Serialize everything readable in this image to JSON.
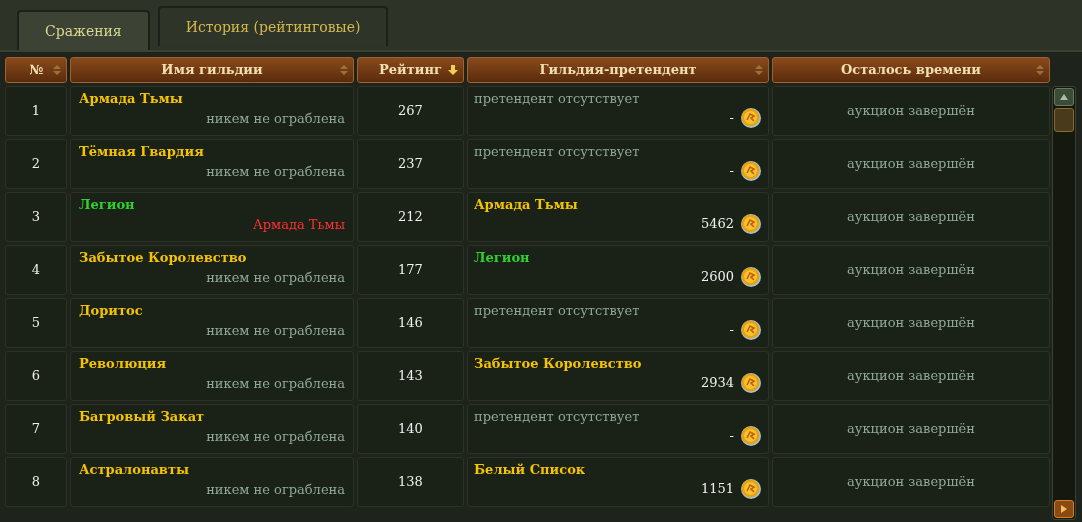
{
  "tabs": [
    {
      "label": "Сражения",
      "selected": true
    },
    {
      "label": "История (рейтинговые)",
      "selected": false
    }
  ],
  "columns": [
    {
      "label": "№",
      "sorted": false
    },
    {
      "label": "Имя гильдии",
      "sorted": false
    },
    {
      "label": "Рейтинг",
      "sorted": true
    },
    {
      "label": "Гильдия-претендент",
      "sorted": false
    },
    {
      "label": "Осталось времени",
      "sorted": false
    }
  ],
  "rows": [
    {
      "rank": "1",
      "guild": {
        "name": "Армада Тьмы",
        "color": "#f5c400"
      },
      "robbed_by": {
        "text": "никем не ограблена",
        "color": "#8fa89a"
      },
      "rating": "267",
      "challenger": {
        "kind": "none",
        "text": "претендент отсутствует",
        "bid": "-"
      },
      "time_left": "аукцион завершён"
    },
    {
      "rank": "2",
      "guild": {
        "name": "Тёмная Гвардия",
        "color": "#f5c400"
      },
      "robbed_by": {
        "text": "никем не ограблена",
        "color": "#8fa89a"
      },
      "rating": "237",
      "challenger": {
        "kind": "none",
        "text": "претендент отсутствует",
        "bid": "-"
      },
      "time_left": "аукцион завершён"
    },
    {
      "rank": "3",
      "guild": {
        "name": "Легион",
        "color": "#2ed12e"
      },
      "robbed_by": {
        "text": "Армада Тьмы",
        "color": "#ff3030"
      },
      "rating": "212",
      "challenger": {
        "kind": "guild",
        "text": "Армада Тьмы",
        "color": "#f5c400",
        "bid": "5462"
      },
      "time_left": "аукцион завершён"
    },
    {
      "rank": "4",
      "guild": {
        "name": "Забытое Королевство",
        "color": "#f5c400"
      },
      "robbed_by": {
        "text": "никем не ограблена",
        "color": "#8fa89a"
      },
      "rating": "177",
      "challenger": {
        "kind": "guild",
        "text": "Легион",
        "color": "#2ed12e",
        "bid": "2600"
      },
      "time_left": "аукцион завершён"
    },
    {
      "rank": "5",
      "guild": {
        "name": "Доритос",
        "color": "#f5c400"
      },
      "robbed_by": {
        "text": "никем не ограблена",
        "color": "#8fa89a"
      },
      "rating": "146",
      "challenger": {
        "kind": "none",
        "text": "претендент отсутствует",
        "bid": "-"
      },
      "time_left": "аукцион завершён"
    },
    {
      "rank": "6",
      "guild": {
        "name": "Революция",
        "color": "#f5c400"
      },
      "robbed_by": {
        "text": "никем не ограблена",
        "color": "#8fa89a"
      },
      "rating": "143",
      "challenger": {
        "kind": "guild",
        "text": "Забытое Королевство",
        "color": "#f5c400",
        "bid": "2934"
      },
      "time_left": "аукцион завершён"
    },
    {
      "rank": "7",
      "guild": {
        "name": "Багровый Закат",
        "color": "#f5c400"
      },
      "robbed_by": {
        "text": "никем не ограблена",
        "color": "#8fa89a"
      },
      "rating": "140",
      "challenger": {
        "kind": "none",
        "text": "претендент отсутствует",
        "bid": "-"
      },
      "time_left": "аукцион завершён"
    },
    {
      "rank": "8",
      "guild": {
        "name": "Астралонавты",
        "color": "#f5c400"
      },
      "robbed_by": {
        "text": "никем не ограблена",
        "color": "#8fa89a"
      },
      "rating": "138",
      "challenger": {
        "kind": "guild",
        "text": "Белый Список",
        "color": "#f5c400",
        "bid": "1151"
      },
      "time_left": "аукцион завершён"
    }
  ]
}
